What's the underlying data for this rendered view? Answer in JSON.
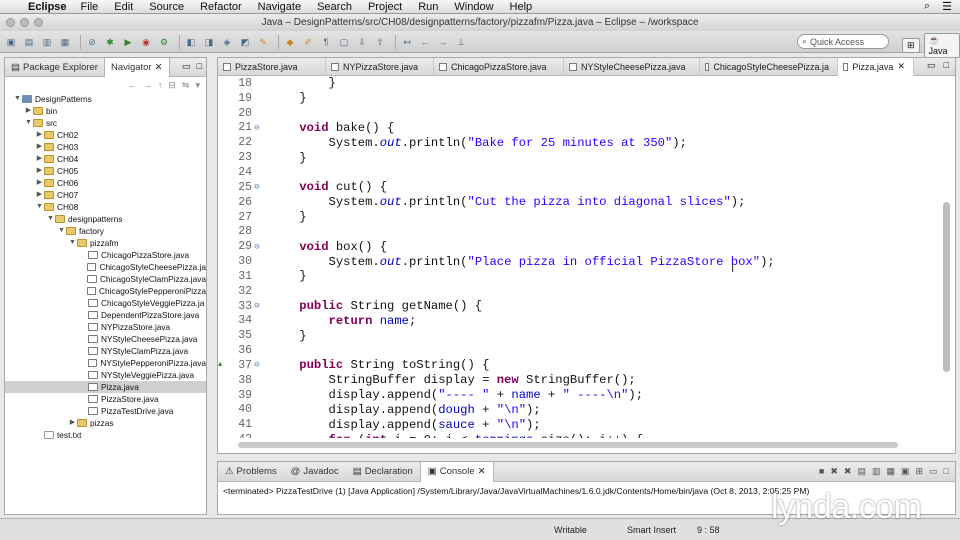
{
  "menubar": {
    "apple": "",
    "app": "Eclipse",
    "items": [
      "File",
      "Edit",
      "Source",
      "Refactor",
      "Navigate",
      "Search",
      "Project",
      "Run",
      "Window",
      "Help"
    ]
  },
  "window": {
    "title": "Java – DesignPatterns/src/CH08/designpatterns/factory/pizzafm/Pizza.java – Eclipse – /workspace"
  },
  "toolbar": {
    "quick_access_placeholder": "Quick Access",
    "perspective": "Java"
  },
  "left_panel": {
    "tabs": [
      "Package Explorer",
      "Navigator"
    ],
    "tree": [
      {
        "label": "DesignPatterns",
        "depth": 0,
        "icon": "proj",
        "tw": "▼"
      },
      {
        "label": "bin",
        "depth": 1,
        "icon": "fold",
        "tw": "▶"
      },
      {
        "label": "src",
        "depth": 1,
        "icon": "fold",
        "tw": "▼"
      },
      {
        "label": "CH02",
        "depth": 2,
        "icon": "fold",
        "tw": "▶"
      },
      {
        "label": "CH03",
        "depth": 2,
        "icon": "fold",
        "tw": "▶"
      },
      {
        "label": "CH04",
        "depth": 2,
        "icon": "fold",
        "tw": "▶"
      },
      {
        "label": "CH05",
        "depth": 2,
        "icon": "fold",
        "tw": "▶"
      },
      {
        "label": "CH06",
        "depth": 2,
        "icon": "fold",
        "tw": "▶"
      },
      {
        "label": "CH07",
        "depth": 2,
        "icon": "fold",
        "tw": "▶"
      },
      {
        "label": "CH08",
        "depth": 2,
        "icon": "fold",
        "tw": "▼"
      },
      {
        "label": "designpatterns",
        "depth": 3,
        "icon": "fold",
        "tw": "▼"
      },
      {
        "label": "factory",
        "depth": 4,
        "icon": "fold",
        "tw": "▼"
      },
      {
        "label": "pizzafm",
        "depth": 5,
        "icon": "fold",
        "tw": "▼"
      },
      {
        "label": "ChicagoPizzaStore.java",
        "depth": 6,
        "icon": "java",
        "tw": ""
      },
      {
        "label": "ChicagoStyleCheesePizza.ja",
        "depth": 6,
        "icon": "java",
        "tw": ""
      },
      {
        "label": "ChicagoStyleClamPizza.java",
        "depth": 6,
        "icon": "java",
        "tw": ""
      },
      {
        "label": "ChicagoStylePepperoniPizza",
        "depth": 6,
        "icon": "java",
        "tw": ""
      },
      {
        "label": "ChicagoStyleVeggiePizza.ja",
        "depth": 6,
        "icon": "java",
        "tw": ""
      },
      {
        "label": "DependentPizzaStore.java",
        "depth": 6,
        "icon": "java",
        "tw": ""
      },
      {
        "label": "NYPizzaStore.java",
        "depth": 6,
        "icon": "java",
        "tw": ""
      },
      {
        "label": "NYStyleCheesePizza.java",
        "depth": 6,
        "icon": "java",
        "tw": ""
      },
      {
        "label": "NYStyleClamPizza.java",
        "depth": 6,
        "icon": "java",
        "tw": ""
      },
      {
        "label": "NYStylePepperoniPizza.java",
        "depth": 6,
        "icon": "java",
        "tw": ""
      },
      {
        "label": "NYStyleVeggiePizza.java",
        "depth": 6,
        "icon": "java",
        "tw": ""
      },
      {
        "label": "Pizza.java",
        "depth": 6,
        "icon": "java",
        "tw": "",
        "selected": true
      },
      {
        "label": "PizzaStore.java",
        "depth": 6,
        "icon": "java",
        "tw": ""
      },
      {
        "label": "PizzaTestDrive.java",
        "depth": 6,
        "icon": "java",
        "tw": ""
      },
      {
        "label": "pizzas",
        "depth": 5,
        "icon": "fold",
        "tw": "▶"
      },
      {
        "label": "test.txt",
        "depth": 2,
        "icon": "txt",
        "tw": ""
      }
    ]
  },
  "editor": {
    "tabs": [
      {
        "label": "PizzaStore.java",
        "width": 108
      },
      {
        "label": "NYPizzaStore.java",
        "width": 108
      },
      {
        "label": "ChicagoPizzaStore.java",
        "width": 130
      },
      {
        "label": "NYStyleCheesePizza.java",
        "width": 136
      },
      {
        "label": "ChicagoStyleCheesePizza.ja",
        "width": 138
      },
      {
        "label": "Pizza.java",
        "width": 76,
        "active": true
      }
    ],
    "lines": [
      {
        "n": "18",
        "f": "",
        "t": [
          [
            "p",
            "        }"
          ]
        ]
      },
      {
        "n": "19",
        "f": "",
        "t": [
          [
            "p",
            "    }"
          ]
        ]
      },
      {
        "n": "20",
        "f": "",
        "t": [
          [
            "p",
            ""
          ]
        ]
      },
      {
        "n": "21",
        "f": "⊖",
        "t": [
          [
            "p",
            "    "
          ],
          [
            "kw",
            "void"
          ],
          [
            "p",
            " bake() {"
          ]
        ]
      },
      {
        "n": "22",
        "f": "",
        "t": [
          [
            "p",
            "        System."
          ],
          [
            "fi",
            "out"
          ],
          [
            "p",
            ".println("
          ],
          [
            "str",
            "\"Bake for 25 minutes at 350\""
          ],
          [
            "p",
            ");"
          ]
        ]
      },
      {
        "n": "23",
        "f": "",
        "t": [
          [
            "p",
            "    }"
          ]
        ]
      },
      {
        "n": "24",
        "f": "",
        "t": [
          [
            "p",
            ""
          ]
        ]
      },
      {
        "n": "25",
        "f": "⊖",
        "t": [
          [
            "p",
            "    "
          ],
          [
            "kw",
            "void"
          ],
          [
            "p",
            " cut() {"
          ]
        ]
      },
      {
        "n": "26",
        "f": "",
        "t": [
          [
            "p",
            "        System."
          ],
          [
            "fi",
            "out"
          ],
          [
            "p",
            ".println("
          ],
          [
            "str",
            "\"Cut the pizza into diagonal slices\""
          ],
          [
            "p",
            ");"
          ]
        ]
      },
      {
        "n": "27",
        "f": "",
        "t": [
          [
            "p",
            "    }"
          ]
        ]
      },
      {
        "n": "28",
        "f": "",
        "t": [
          [
            "p",
            ""
          ]
        ]
      },
      {
        "n": "29",
        "f": "⊖",
        "t": [
          [
            "p",
            "    "
          ],
          [
            "kw",
            "void"
          ],
          [
            "p",
            " box() {"
          ]
        ]
      },
      {
        "n": "30",
        "f": "",
        "t": [
          [
            "p",
            "        System."
          ],
          [
            "fi",
            "out"
          ],
          [
            "p",
            ".println("
          ],
          [
            "str",
            "\"Place pizza in official PizzaStore box\""
          ],
          [
            "p",
            ");"
          ]
        ]
      },
      {
        "n": "31",
        "f": "",
        "t": [
          [
            "p",
            "    }"
          ]
        ]
      },
      {
        "n": "32",
        "f": "",
        "t": [
          [
            "p",
            ""
          ]
        ]
      },
      {
        "n": "33",
        "f": "⊖",
        "t": [
          [
            "p",
            "    "
          ],
          [
            "kw",
            "public"
          ],
          [
            "p",
            " String getName() {"
          ]
        ]
      },
      {
        "n": "34",
        "f": "",
        "t": [
          [
            "p",
            "        "
          ],
          [
            "kw",
            "return"
          ],
          [
            "p",
            " "
          ],
          [
            "fld",
            "name"
          ],
          [
            "p",
            ";"
          ]
        ]
      },
      {
        "n": "35",
        "f": "",
        "t": [
          [
            "p",
            "    }"
          ]
        ]
      },
      {
        "n": "36",
        "f": "",
        "t": [
          [
            "p",
            ""
          ]
        ]
      },
      {
        "n": "37",
        "f": "⊖",
        "ov": "▲",
        "t": [
          [
            "p",
            "    "
          ],
          [
            "kw",
            "public"
          ],
          [
            "p",
            " String toString() {"
          ]
        ]
      },
      {
        "n": "38",
        "f": "",
        "t": [
          [
            "p",
            "        StringBuffer display = "
          ],
          [
            "kw",
            "new"
          ],
          [
            "p",
            " StringBuffer();"
          ]
        ]
      },
      {
        "n": "39",
        "f": "",
        "t": [
          [
            "p",
            "        display.append("
          ],
          [
            "str",
            "\"---- \""
          ],
          [
            "p",
            " + "
          ],
          [
            "fld",
            "name"
          ],
          [
            "p",
            " + "
          ],
          [
            "str",
            "\" ----\\n\""
          ],
          [
            "p",
            ");"
          ]
        ]
      },
      {
        "n": "40",
        "f": "",
        "t": [
          [
            "p",
            "        display.append("
          ],
          [
            "fld",
            "dough"
          ],
          [
            "p",
            " + "
          ],
          [
            "str",
            "\"\\n\""
          ],
          [
            "p",
            ");"
          ]
        ]
      },
      {
        "n": "41",
        "f": "",
        "t": [
          [
            "p",
            "        display.append("
          ],
          [
            "fld",
            "sauce"
          ],
          [
            "p",
            " + "
          ],
          [
            "str",
            "\"\\n\""
          ],
          [
            "p",
            ");"
          ]
        ]
      },
      {
        "n": "42",
        "f": "",
        "t": [
          [
            "p",
            "        "
          ],
          [
            "kw",
            "for"
          ],
          [
            "p",
            " ("
          ],
          [
            "kw",
            "int"
          ],
          [
            "p",
            " i = 0; i < "
          ],
          [
            "fld",
            "toppings"
          ],
          [
            "p",
            ".size(); i++) {"
          ]
        ]
      }
    ]
  },
  "console": {
    "tabs": [
      "Problems",
      "Javadoc",
      "Declaration",
      "Console"
    ],
    "text": "<terminated> PizzaTestDrive (1) [Java Application] /System/Library/Java/JavaVirtualMachines/1.6.0.jdk/Contents/Home/bin/java (Oct 8, 2013, 2:05:25 PM)"
  },
  "status": {
    "writable": "Writable",
    "insert": "Smart Insert",
    "position": "9 : 58"
  },
  "watermark": "lynda.com"
}
